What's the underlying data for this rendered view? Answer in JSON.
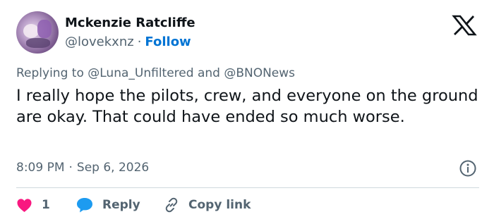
{
  "author": {
    "name": "Mckenzie Ratcliffe",
    "handle": "@lovekxnz",
    "separator": "·",
    "follow_label": "Follow"
  },
  "reply_context": {
    "prefix": "Replying to",
    "mentions": [
      "@Luna_Unfiltered",
      "@BNONews"
    ],
    "conjunction": "and"
  },
  "tweet": {
    "text": "I really hope the pilots, crew, and everyone on the ground are okay. That could have ended so much worse."
  },
  "meta": {
    "time": "8:09 PM",
    "separator": "·",
    "date": "Sep 6, 2026"
  },
  "actions": {
    "like_count": "1",
    "reply_label": "Reply",
    "copy_label": "Copy link"
  },
  "colors": {
    "text": "#0f1419",
    "secondary": "#536471",
    "link": "#0074d4",
    "like": "#f91880",
    "reply": "#1d9bf0",
    "divider": "#cfd9de"
  },
  "icons": [
    "x-logo-icon",
    "info-icon",
    "heart-icon",
    "reply-bubble-icon",
    "link-icon"
  ]
}
